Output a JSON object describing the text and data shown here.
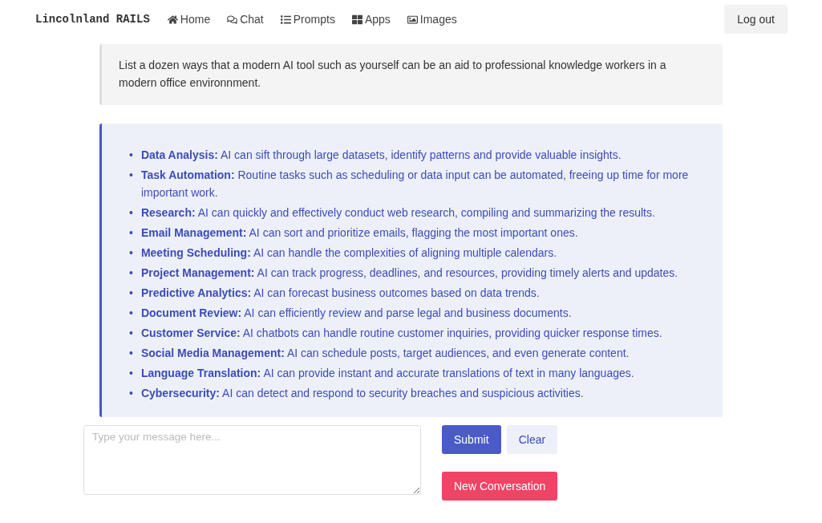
{
  "navbar": {
    "brand": "Lincolnland RAILS",
    "links": [
      {
        "kind": "home",
        "label": "Home"
      },
      {
        "kind": "chat",
        "label": "Chat"
      },
      {
        "kind": "list",
        "label": "Prompts"
      },
      {
        "kind": "apps",
        "label": "Apps"
      },
      {
        "kind": "image",
        "label": "Images"
      }
    ],
    "logout": "Log out"
  },
  "prompt": "List a dozen ways that a modern AI tool such as yourself can be an aid to professional knowledge workers in a modern office environnment.",
  "response": [
    {
      "marker": "•",
      "text": "**Data Analysis:** AI can sift through large datasets, identify patterns and provide valuable insights."
    },
    {
      "marker": "•",
      "text": "**Task Automation:** Routine tasks such as scheduling or data input can be automated, freeing up time for more important work."
    },
    {
      "marker": "•",
      "text": "**Research:** AI can quickly and effectively conduct web research, compiling and summarizing the results."
    },
    {
      "marker": "•",
      "text": "**Email Management:** AI can sort and prioritize emails, flagging the most important ones."
    },
    {
      "marker": "•",
      "text": "**Meeting Scheduling:** AI can handle the complexities of aligning multiple calendars."
    },
    {
      "marker": "•",
      "text": "**Project Management:** AI can track progress, deadlines, and resources, providing timely alerts and updates."
    },
    {
      "marker": "•",
      "text": "**Predictive Analytics:** AI can forecast business outcomes based on data trends."
    },
    {
      "marker": "•",
      "text": "**Document Review:** AI can efficiently review and parse legal and business documents."
    },
    {
      "marker": "•",
      "text": "**Customer Service:** AI chatbots can handle routine customer inquiries, providing quicker response times."
    },
    {
      "marker": "•",
      "text": "**Social Media Management:** AI can schedule posts, target audiences, and even generate content."
    },
    {
      "marker": "•",
      "text": "**Language Translation:** AI can provide instant and accurate translations of text in many languages."
    },
    {
      "marker": "•",
      "text": "**Cybersecurity:** AI can detect and respond to security breaches and suspicious activities."
    }
  ],
  "form": {
    "placeholder": "Type your message here...",
    "submit": "Submit",
    "clear": "Clear",
    "new_conversation": "New Conversation"
  }
}
